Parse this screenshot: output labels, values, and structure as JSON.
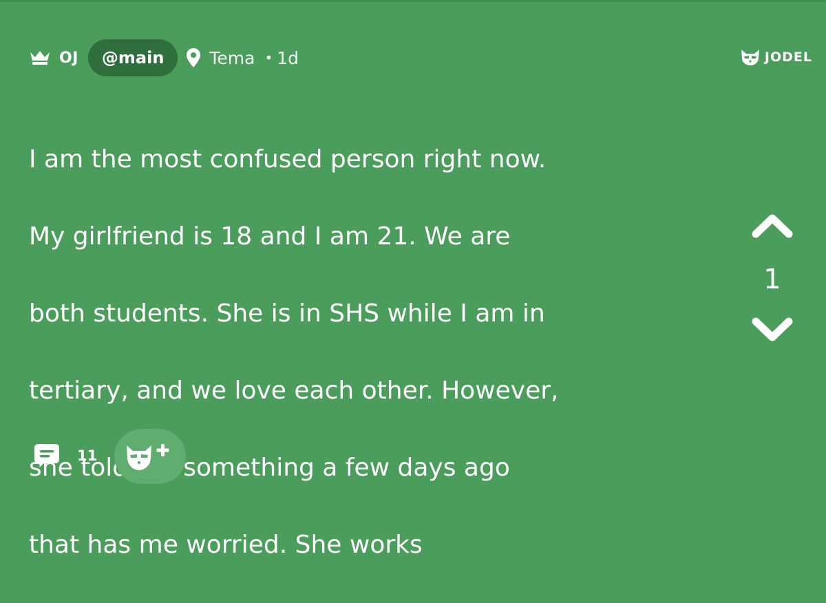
{
  "header": {
    "author": "OJ",
    "channel": "@main",
    "location": "Tema",
    "separator": "•",
    "time": "1d"
  },
  "brand": {
    "name": "JODEL"
  },
  "post": {
    "lines": [
      "I am the most confused person right now.",
      "My girlfriend is 18 and I am 21. We are",
      "both students. She is in SHS while I am in",
      "tertiary, and we love each other. However,",
      "she told me something a few days ago",
      "that has me worried. She works"
    ]
  },
  "votes": {
    "count": "1",
    "up_icon": "chevron-up-icon",
    "down_icon": "chevron-down-icon"
  },
  "footer": {
    "comment_count": "11",
    "comment_icon": "comment-icon",
    "add_icon": "jodel-plus-icon"
  },
  "colors": {
    "background": "#4a9d5b",
    "channel_pill": "#2f6f3e",
    "add_button": "#5fae70",
    "text": "#ffffff"
  }
}
